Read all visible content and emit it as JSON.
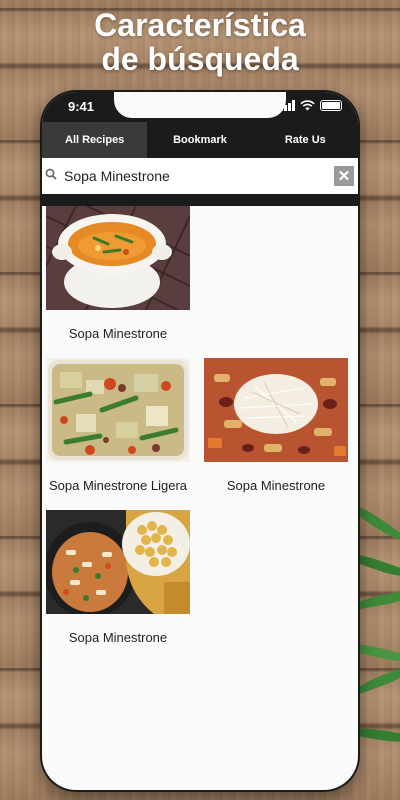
{
  "promo": {
    "line1": "Característica",
    "line2": "de búsqueda"
  },
  "statusbar": {
    "time": "9:41"
  },
  "tabs": [
    {
      "label": "All Recipes",
      "active": true
    },
    {
      "label": "Bookmark",
      "active": false
    },
    {
      "label": "Rate Us",
      "active": false
    }
  ],
  "search": {
    "value": "Sopa Minestrone",
    "icon": "search-icon",
    "clear_icon": "close-icon",
    "clear_label": "✕"
  },
  "results": [
    {
      "title": "Sopa Minestrone",
      "image": "soup-bowl"
    },
    {
      "title": "Sopa Minestrone Ligera",
      "image": "vegetable-soup"
    },
    {
      "title": "Sopa Minestrone",
      "image": "pasta-soup"
    },
    {
      "title": "Sopa Minestrone",
      "image": "slow-cooker-soup"
    }
  ],
  "colors": {
    "bar": "#1b1b1b",
    "active_tab": "#3a3a3a",
    "screen_bg": "#fafafa"
  }
}
